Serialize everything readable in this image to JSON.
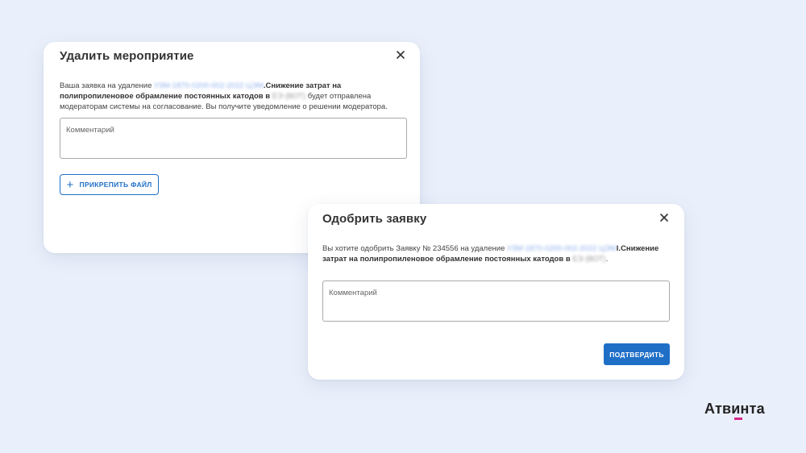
{
  "dialog_delete": {
    "title": "Удалить мероприятие",
    "msg_prefix": "Ваша заявка на удаление ",
    "msg_code_blurred": "УЗМ-1870-0200-002-2022 ЦЭМ",
    "msg_event_bold": ".Снижение затрат на полипропиленовое обрамление постоянных катодов в ",
    "msg_org_blurred": "ЕЭ (ВОТ)",
    "msg_suffix": " будет отправлена модераторам системы на согласование. Вы получите уведомление о решении модератора.",
    "comment_placeholder": "Комментарий",
    "attach_label": "ПРИКРЕПИТЬ ФАЙЛ"
  },
  "dialog_approve": {
    "title": "Одобрить заявку",
    "msg_prefix": "Вы хотите одобрить Заявку № 234556 на удаление ",
    "msg_code_blurred": "УЗМ-1870-0200-002-2022 ЦЭМ",
    "msg_event_bold": "I.Снижение затрат на полипропиленовое обрамление постоянных катодов в ",
    "msg_org_blurred": "ЕЭ (ВОТ)",
    "msg_suffix": ".",
    "comment_placeholder": "Комментарий",
    "confirm_label": "ПОДТВЕРДИТЬ"
  },
  "brand": {
    "logo_text": "Атвинта",
    "accent_color": "#d8258b"
  },
  "colors": {
    "primary": "#1f6fc7",
    "background": "#eaf0fb"
  }
}
